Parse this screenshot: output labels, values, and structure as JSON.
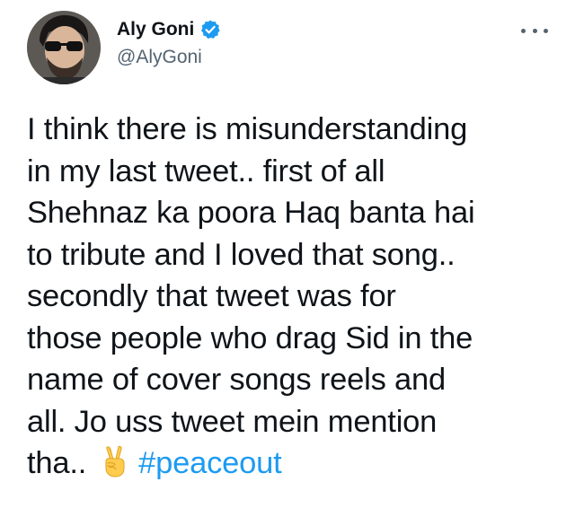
{
  "author": {
    "display_name": "Aly Goni",
    "handle": "@AlyGoni",
    "verified": true,
    "avatar_icon": "profile-photo"
  },
  "menu_icon": "more-options-icon",
  "tweet": {
    "lines": [
      "I think there is misunderstanding",
      "in my last tweet.. first of all",
      "Shehnaz ka poora Haq banta hai",
      "to tribute and I loved that song..",
      "secondly that tweet was for",
      "those people who drag Sid in the",
      "name of cover songs reels and",
      "all. Jo uss tweet mein mention"
    ],
    "last_line_text": "tha..",
    "emoji": "victory-hand-emoji",
    "hashtag": "#peaceout"
  },
  "colors": {
    "text": "#0f1419",
    "secondary": "#536471",
    "accent": "#1d9bf0"
  }
}
